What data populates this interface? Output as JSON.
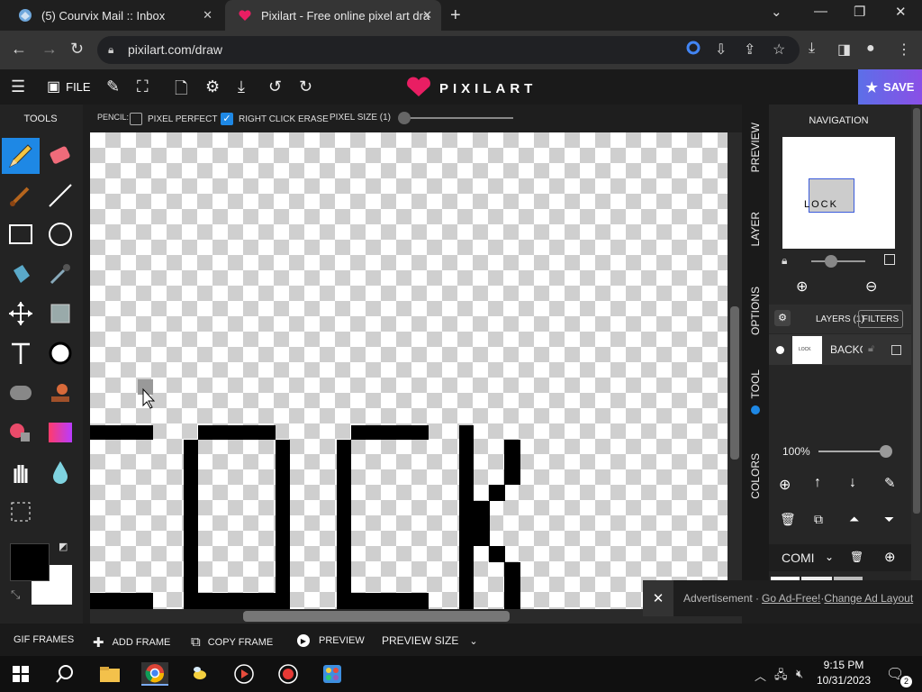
{
  "browser": {
    "tabs": [
      {
        "title": "(5) Courvix Mail :: Inbox"
      },
      {
        "title": "Pixilart - Free online pixel art dra"
      }
    ],
    "url": "pixilart.com/draw"
  },
  "app": {
    "file_label": "FILE",
    "brand": "PIXILART",
    "save_label": "SAVE",
    "tools_title": "TOOLS",
    "accent": "#1e88e5"
  },
  "optionbar": {
    "tool_name": "PENCIL:",
    "pixel_perfect": "PIXEL PERFECT",
    "pixel_perfect_checked": false,
    "right_click_erase": "RIGHT CLICK ERASE",
    "right_click_erase_checked": true,
    "pixel_size": "PIXEL SIZE (1)"
  },
  "sidetabs": [
    "PREVIEW",
    "LAYER",
    "OPTIONS",
    "TOOL",
    "COLORS"
  ],
  "panel": {
    "navigation_title": "NAVIGATION",
    "layers_title": "LAYERS (1)",
    "filters_label": "FILTERS",
    "layer_name": "BACKG",
    "layer_thumb_text": "LOCK",
    "opacity": "100%",
    "blend_mode": "COMI"
  },
  "ad": {
    "label": "Advertisement · ",
    "go_ad_free": "Go Ad-Free!",
    "sep": " · ",
    "change_layout": "Change Ad Layout"
  },
  "frames": {
    "gif_frames": "GIF FRAMES",
    "add_frame": "ADD FRAME",
    "copy_frame": "COPY FRAME",
    "preview": "PREVIEW",
    "preview_size": "PREVIEW SIZE"
  },
  "taskbar": {
    "time": "9:15 PM",
    "date": "10/31/2023",
    "notifications": "2"
  }
}
